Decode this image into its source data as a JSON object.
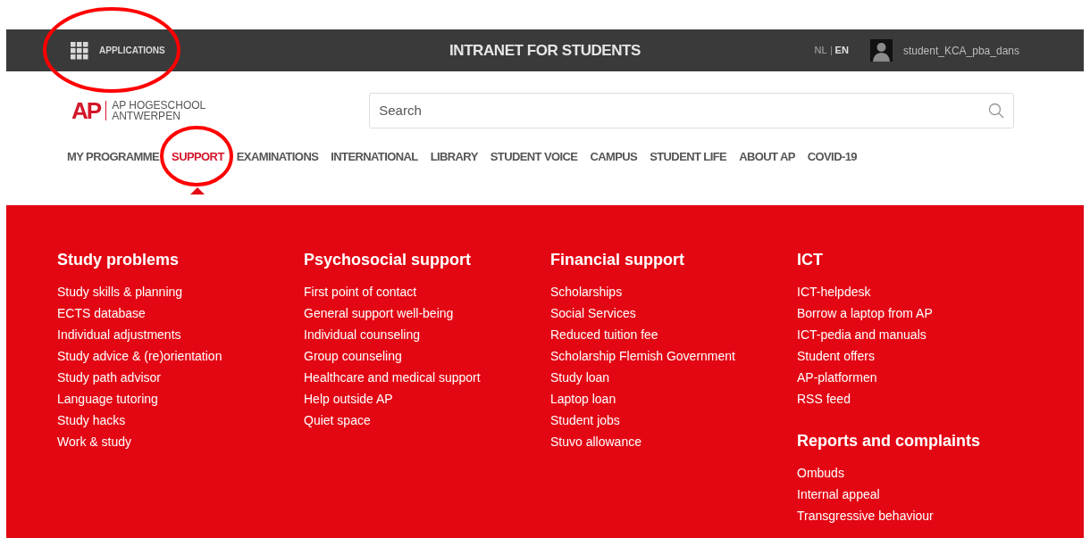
{
  "top_bar": {
    "apps_label": "APPLICATIONS",
    "title": "INTRANET FOR STUDENTS",
    "languages": [
      {
        "label": "NL",
        "selected": false
      },
      {
        "label": "EN",
        "selected": true
      }
    ],
    "username": "student_KCA_pba_dans"
  },
  "logo": {
    "mark": "AP",
    "line1": "AP HOGESCHOOL",
    "line2": "ANTWERPEN"
  },
  "search": {
    "placeholder": "Search"
  },
  "nav": [
    {
      "label": "MY PROGRAMME",
      "selected": false
    },
    {
      "label": "SUPPORT",
      "selected": true
    },
    {
      "label": "EXAMINATIONS",
      "selected": false
    },
    {
      "label": "INTERNATIONAL",
      "selected": false
    },
    {
      "label": "LIBRARY",
      "selected": false
    },
    {
      "label": "STUDENT VOICE",
      "selected": false
    },
    {
      "label": "CAMPUS",
      "selected": false
    },
    {
      "label": "STUDENT LIFE",
      "selected": false
    },
    {
      "label": "ABOUT AP",
      "selected": false
    },
    {
      "label": "COVID-19",
      "selected": false
    }
  ],
  "menu_columns": [
    {
      "sections": [
        {
          "heading": "Study problems",
          "links": [
            "Study skills & planning",
            "ECTS database",
            "Individual adjustments",
            "Study advice & (re)orientation",
            "Study path advisor",
            "Language tutoring",
            "Study hacks",
            "Work & study"
          ]
        }
      ]
    },
    {
      "sections": [
        {
          "heading": "Psychosocial support",
          "links": [
            "First point of contact",
            "General support well-being",
            "Individual counseling",
            "Group counseling",
            "Healthcare and medical support",
            "Help outside AP",
            "Quiet space"
          ]
        }
      ]
    },
    {
      "sections": [
        {
          "heading": "Financial support",
          "links": [
            "Scholarships",
            "Social Services",
            "Reduced tuition fee",
            "Scholarship Flemish Government",
            "Study loan",
            "Laptop loan",
            "Student jobs",
            "Stuvo allowance"
          ]
        }
      ]
    },
    {
      "sections": [
        {
          "heading": "ICT",
          "links": [
            "ICT-helpdesk",
            "Borrow a laptop from AP",
            "ICT-pedia and manuals",
            "Student offers",
            "AP-platformen",
            "RSS feed"
          ]
        },
        {
          "heading": "Reports and complaints",
          "links": [
            "Ombuds",
            "Internal appeal",
            "Transgressive behaviour"
          ]
        }
      ]
    }
  ]
}
